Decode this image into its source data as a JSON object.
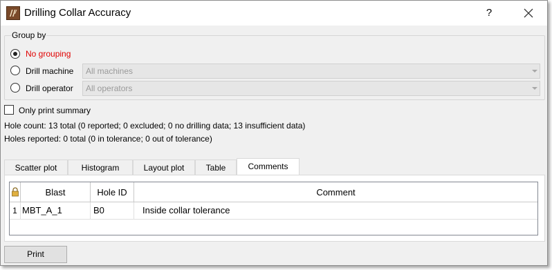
{
  "window": {
    "title": "Drilling Collar Accuracy",
    "help_label": "?"
  },
  "group_by": {
    "title": "Group by",
    "options": [
      {
        "label": "No grouping",
        "selected": true
      },
      {
        "label": "Drill machine",
        "selected": false,
        "combo_value": "All machines"
      },
      {
        "label": "Drill operator",
        "selected": false,
        "combo_value": "All operators"
      }
    ]
  },
  "summary_checkbox": {
    "label": "Only print summary",
    "checked": false
  },
  "info": {
    "hole_count": "Hole count: 13 total (0 reported; 0 excluded; 0 no drilling data; 13 insufficient data)",
    "holes_reported": "Holes reported: 0 total (0 in tolerance; 0 out of tolerance)"
  },
  "tabs": [
    {
      "label": "Scatter plot",
      "active": false
    },
    {
      "label": "Histogram",
      "active": false
    },
    {
      "label": "Layout plot",
      "active": false
    },
    {
      "label": "Table",
      "active": false
    },
    {
      "label": "Comments",
      "active": true
    }
  ],
  "comments_table": {
    "columns": [
      "Blast",
      "Hole ID",
      "Comment"
    ],
    "rows": [
      {
        "index": "1",
        "blast": "MBT_A_1",
        "hole_id": "B0",
        "comment": "Inside collar tolerance"
      }
    ]
  },
  "print_button": {
    "label": "Print"
  },
  "colors": {
    "active_option": "#e00000",
    "disabled_text": "#9a9a9a"
  }
}
